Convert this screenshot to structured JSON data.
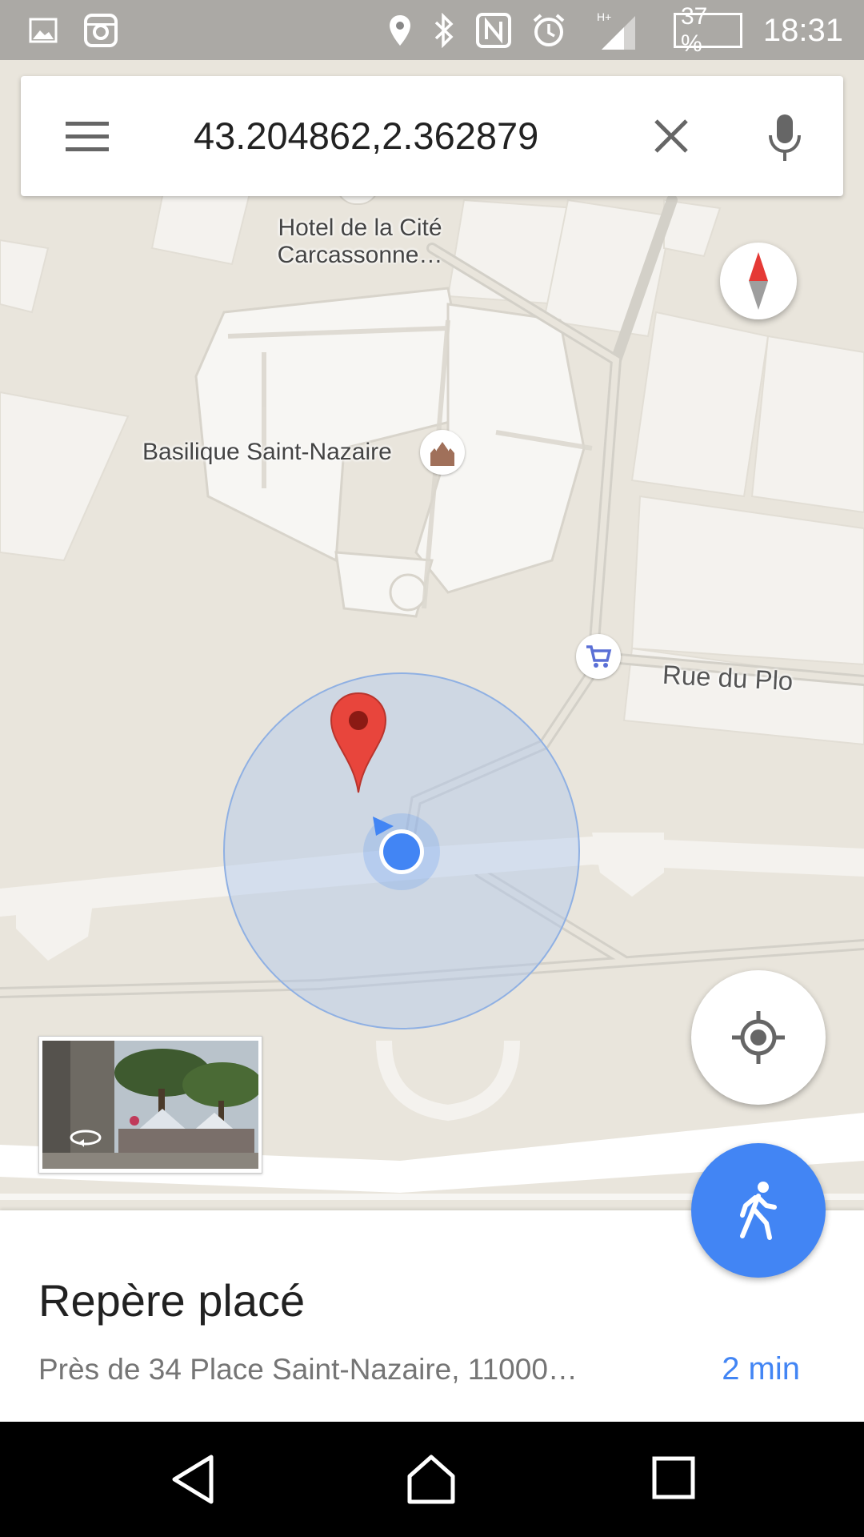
{
  "status_bar": {
    "battery_text": "37 %",
    "time": "18:31",
    "icons": [
      "gallery-icon",
      "instagram-icon",
      "location-icon",
      "bluetooth-icon",
      "nfc-icon",
      "alarm-icon",
      "signal-icon",
      "battery-icon"
    ]
  },
  "search": {
    "query": "43.204862,2.362879",
    "icons": [
      "menu-icon",
      "clear-icon",
      "microphone-icon"
    ]
  },
  "map": {
    "labels": {
      "hotel_line1": "Hotel de la Cité",
      "hotel_line2": "Carcassonne…",
      "basilique": "Basilique Saint-Nazaire",
      "street": "Rue du Plo"
    },
    "pin_color": "#e8453c",
    "location_color": "#4285f4"
  },
  "place": {
    "title": "Repère placé",
    "address": "Près de 34 Place Saint-Nazaire, 11000…",
    "eta": "2 min"
  },
  "colors": {
    "accent": "#4285f4",
    "map_bg": "#e9e5dc"
  }
}
